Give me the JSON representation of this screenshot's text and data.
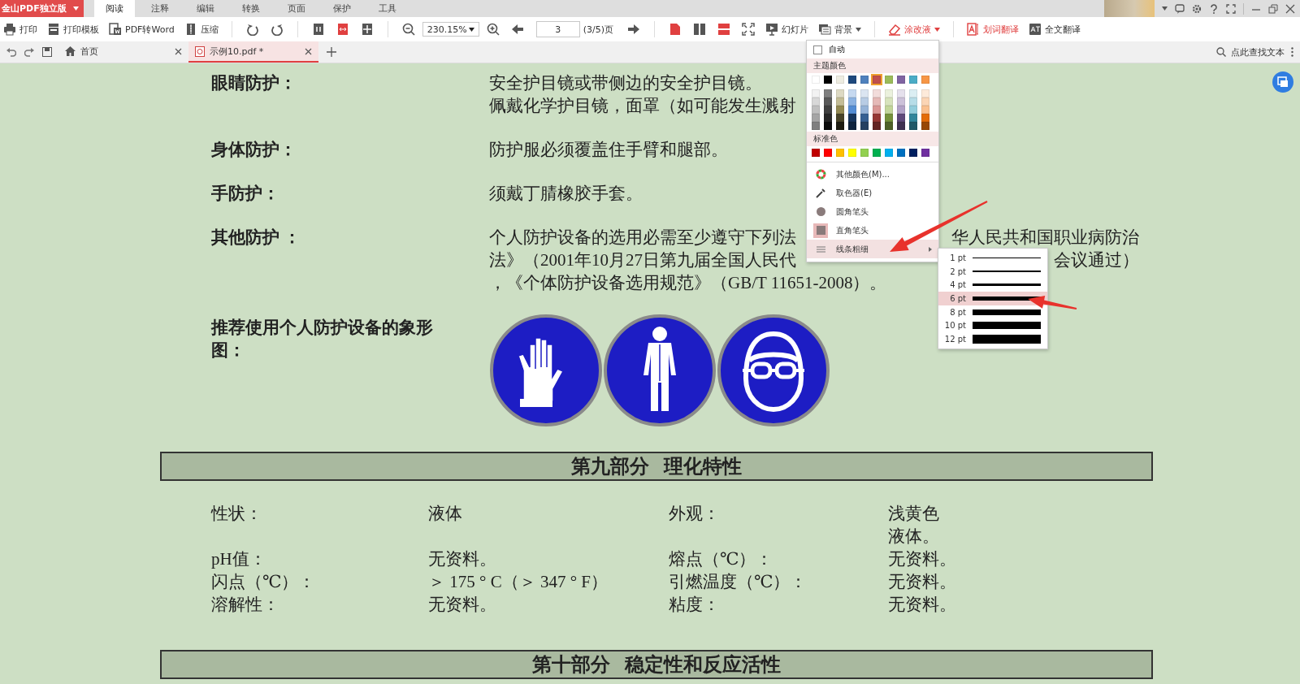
{
  "app": {
    "brand": "金山PDF独立版",
    "menu_tabs": [
      {
        "label": "阅读",
        "selected": true
      },
      {
        "label": "注释",
        "selected": false
      },
      {
        "label": "编辑",
        "selected": false
      },
      {
        "label": "转换",
        "selected": false
      },
      {
        "label": "页面",
        "selected": false
      },
      {
        "label": "保护",
        "selected": false
      },
      {
        "label": "工具",
        "selected": false
      }
    ]
  },
  "toolbar": [
    {
      "kind": "labeled",
      "label": "打印",
      "active": false
    },
    {
      "kind": "labeled",
      "label": "打印模板",
      "active": false
    },
    {
      "kind": "labeled",
      "label": "PDF转Word",
      "active": false
    },
    {
      "kind": "labeled",
      "label": "压缩",
      "active": false
    },
    {
      "kind": "sep"
    },
    {
      "kind": "icon"
    },
    {
      "kind": "icon"
    },
    {
      "kind": "sep"
    },
    {
      "kind": "icon"
    },
    {
      "kind": "icon"
    },
    {
      "kind": "icon"
    },
    {
      "kind": "sep"
    },
    {
      "kind": "icon"
    },
    {
      "kind": "zoom",
      "value": "230.15%"
    },
    {
      "kind": "icon"
    },
    {
      "kind": "icon"
    },
    {
      "kind": "page",
      "value": "3",
      "suffix": "(3/5)页"
    },
    {
      "kind": "icon"
    },
    {
      "kind": "sep"
    },
    {
      "kind": "icon"
    },
    {
      "kind": "icon"
    },
    {
      "kind": "icon"
    },
    {
      "kind": "icon"
    },
    {
      "kind": "labeled",
      "label": "幻灯片",
      "active": false
    },
    {
      "kind": "dropdown",
      "label": "背景",
      "active": false
    },
    {
      "kind": "sep"
    },
    {
      "kind": "dropdown",
      "label": "涂改液",
      "active": true
    },
    {
      "kind": "sep"
    },
    {
      "kind": "labeled",
      "label": "划词翻译",
      "active": true
    },
    {
      "kind": "labeled",
      "label": "全文翻译",
      "active": false
    }
  ],
  "tabs": [
    {
      "label": "首页",
      "selected": false
    },
    {
      "label": "示例10.pdf *",
      "selected": true
    }
  ],
  "search": {
    "placeholder": "点此查找文本"
  },
  "document": {
    "protection": [
      {
        "label": "眼睛防护：",
        "lines": [
          [
            "安全护目镜或带侧边的安全护目镜。"
          ],
          [
            "佩戴化学护目镜，面罩（如可能发生溅射"
          ]
        ]
      },
      {
        "label": "身体防护：",
        "lines": [
          [
            "防护服必须覆盖住手臂和腿部。"
          ]
        ]
      },
      {
        "label": "手防护：",
        "lines": [
          [
            "须戴丁腈橡胶手套。"
          ]
        ]
      },
      {
        "label": "其他防护 ：",
        "lines": [
          [
            "个人防护设备的选用必需至少遵守下列法",
            "华人民共和国职业病防治"
          ],
          [
            "法》（2001年10月27日第九届全国人民代",
            "会议通过）"
          ],
          [
            "，《个体防护设备选用规范》（GB/T 11651-2008）。"
          ]
        ]
      }
    ],
    "pictogram_label": "推荐使用个人防护设备的象形图：",
    "sections": [
      {
        "title": "第九部分 理化特性",
        "rows": [
          [
            "性状：",
            "液体",
            "外观：",
            [
              "浅黄色",
              "液体。"
            ]
          ],
          [
            "pH值：",
            "无资料。",
            "熔点（℃）：",
            "无资料。"
          ],
          [
            "闪点（℃）：",
            "＞ 175 ° C（＞ 347 ° F）",
            "引燃温度（℃）：",
            "无资料。"
          ],
          [
            "溶解性：",
            "无资料。",
            "粘度：",
            "无资料。"
          ]
        ]
      },
      {
        "title": "第十部分 稳定性和反应活性"
      }
    ]
  },
  "color_menu": {
    "auto": {
      "label": "自动",
      "checked": false
    },
    "theme_title": "主题颜色",
    "theme_colors": [
      {
        "color": "#ffffff",
        "selected": false
      },
      {
        "color": "#000000",
        "selected": false
      },
      {
        "color": "#eeece1",
        "selected": false
      },
      {
        "color": "#1f497d",
        "selected": false
      },
      {
        "color": "#4f81bd",
        "selected": false
      },
      {
        "color": "#c0504d",
        "selected": true
      },
      {
        "color": "#9bbb59",
        "selected": false
      },
      {
        "color": "#8064a2",
        "selected": false
      },
      {
        "color": "#4bacc6",
        "selected": false
      },
      {
        "color": "#f79646",
        "selected": false
      }
    ],
    "shades": [
      [
        {
          "color": "#f2f2f2"
        },
        {
          "color": "#7f7f7f"
        },
        {
          "color": "#ddd9c3"
        },
        {
          "color": "#c6d9f0"
        },
        {
          "color": "#dbe5f1"
        },
        {
          "color": "#f2dcdb"
        },
        {
          "color": "#ebf1dd"
        },
        {
          "color": "#e5e0ec"
        },
        {
          "color": "#dbeef3"
        },
        {
          "color": "#fdeada"
        }
      ],
      [
        {
          "color": "#d8d8d8"
        },
        {
          "color": "#595959"
        },
        {
          "color": "#c4bd97"
        },
        {
          "color": "#8db3e2"
        },
        {
          "color": "#b8cce4"
        },
        {
          "color": "#e5b9b7"
        },
        {
          "color": "#d7e3bc"
        },
        {
          "color": "#ccc1d9"
        },
        {
          "color": "#b7dde8"
        },
        {
          "color": "#fbd5b5"
        }
      ],
      [
        {
          "color": "#bfbfbf"
        },
        {
          "color": "#3f3f3f"
        },
        {
          "color": "#938953"
        },
        {
          "color": "#548dd4"
        },
        {
          "color": "#95b3d7"
        },
        {
          "color": "#d99694"
        },
        {
          "color": "#c3d69b"
        },
        {
          "color": "#b2a2c7"
        },
        {
          "color": "#92cddc"
        },
        {
          "color": "#fac08f"
        }
      ],
      [
        {
          "color": "#a5a5a5"
        },
        {
          "color": "#262626"
        },
        {
          "color": "#494429"
        },
        {
          "color": "#17365d"
        },
        {
          "color": "#366092"
        },
        {
          "color": "#953734"
        },
        {
          "color": "#76923c"
        },
        {
          "color": "#5f497a"
        },
        {
          "color": "#31859b"
        },
        {
          "color": "#e36c09"
        }
      ],
      [
        {
          "color": "#7f7f7f"
        },
        {
          "color": "#0c0c0c"
        },
        {
          "color": "#1d1b10"
        },
        {
          "color": "#0f243e"
        },
        {
          "color": "#244061"
        },
        {
          "color": "#632423"
        },
        {
          "color": "#4f6128"
        },
        {
          "color": "#3f3151"
        },
        {
          "color": "#205867"
        },
        {
          "color": "#974806"
        }
      ]
    ],
    "standard_title": "标准色",
    "standard_colors": [
      {
        "color": "#c00000"
      },
      {
        "color": "#ff0000"
      },
      {
        "color": "#ffc000"
      },
      {
        "color": "#ffff00"
      },
      {
        "color": "#92d050"
      },
      {
        "color": "#00b050"
      },
      {
        "color": "#00b0f0"
      },
      {
        "color": "#0070c0"
      },
      {
        "color": "#002060"
      },
      {
        "color": "#7030a0"
      }
    ],
    "items": [
      {
        "kind": "palette",
        "label": "其他颜色(M)..."
      },
      {
        "kind": "picker",
        "label": "取色器(E)"
      },
      {
        "kind": "round-pen",
        "label": "圆角笔头",
        "selected": false
      },
      {
        "kind": "square-pen",
        "label": "直角笔头",
        "selected": true
      },
      {
        "kind": "submenu",
        "label": "线条粗细",
        "expanded": true
      }
    ],
    "line_widths": [
      {
        "label": "1 pt",
        "selected": false
      },
      {
        "label": "2 pt",
        "selected": false
      },
      {
        "label": "4 pt",
        "selected": false
      },
      {
        "label": "6 pt",
        "selected": true
      },
      {
        "label": "8 pt",
        "selected": false
      },
      {
        "label": "10 pt",
        "selected": false
      },
      {
        "label": "12 pt",
        "selected": false
      }
    ]
  }
}
